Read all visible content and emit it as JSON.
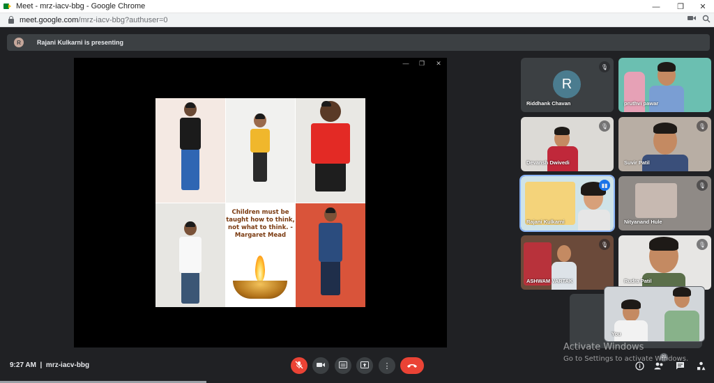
{
  "window": {
    "title": "Meet - mrz-iacv-bbg - Google Chrome",
    "controls": {
      "minimize": "—",
      "restore": "❐",
      "close": "✕"
    }
  },
  "address_bar": {
    "url_host": "meet.google.com",
    "url_path": "/mrz-iacv-bbg?authuser=0",
    "icons": [
      "lock-icon",
      "camera-blocked-icon",
      "zoom-icon"
    ]
  },
  "presenting": {
    "avatar_letter": "R",
    "text": "Rajani Kulkarni is presenting"
  },
  "presentation": {
    "window_controls": {
      "minimize": "—",
      "restore": "❐",
      "close": "✕"
    },
    "quote": "Children must be taught how to think, not what to think. - Margaret Mead"
  },
  "participants": [
    {
      "name": "Riddhank Chavan",
      "avatar_letter": "R",
      "muted": true
    },
    {
      "name": "pruthvi pawar",
      "muted": false
    },
    {
      "name": "Devansh Dwivedi",
      "muted": true
    },
    {
      "name": "Suvir Patil",
      "muted": true
    },
    {
      "name": "Rajani Kulkarni",
      "muted": false,
      "speaking": true
    },
    {
      "name": "Nityanand Hule",
      "muted": true
    },
    {
      "name": "ASHWAM VARTAK",
      "muted": true
    },
    {
      "name": "Rudra Patil",
      "muted": true
    },
    {
      "name": "You",
      "muted": false
    }
  ],
  "bottom": {
    "time": "9:27 AM",
    "separator": "|",
    "meeting_code": "mrz-iacv-bbg",
    "controls": [
      "mic-off-icon",
      "camera-icon",
      "captions-icon",
      "present-icon",
      "more-icon",
      "hangup-icon"
    ],
    "right_icons": [
      "info-icon",
      "people-icon",
      "chat-icon",
      "activities-icon"
    ],
    "people_count": "20"
  },
  "watermark": {
    "title": "Activate Windows",
    "subtitle": "Go to Settings to activate Windows."
  },
  "colors": {
    "background": "#202124",
    "panel": "#3c4043",
    "danger": "#ea4335",
    "accent": "#8ab4f8"
  }
}
